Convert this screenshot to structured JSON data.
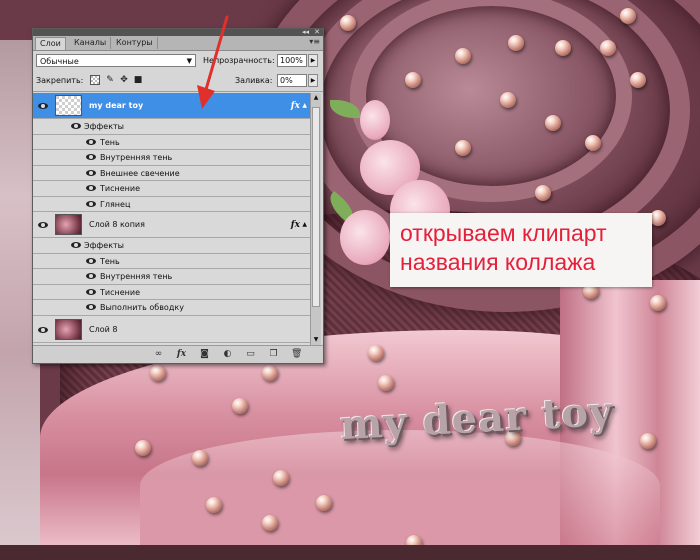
{
  "panel": {
    "tabs": [
      "Слои",
      "Каналы",
      "Контуры"
    ],
    "active_tab": 0,
    "collapse_glyph": "◂◂",
    "close_glyph": "✕",
    "menu_glyph": "▾≡",
    "blend_mode": "Обычные",
    "opacity_label": "Непрозрачность:",
    "opacity_value": "100%",
    "lock_label": "Закрепить:",
    "fill_label": "Заливка:",
    "fill_value": "0%",
    "lock_icons": [
      "lock-transparent-icon",
      "lock-paint-icon",
      "lock-move-icon",
      "lock-all-icon"
    ]
  },
  "layers": [
    {
      "name": "my dear toy",
      "selected": true,
      "thumb": "transparent",
      "fx": "fx"
    },
    {
      "effects_label": "Эффекты",
      "effects": [
        "Тень",
        "Внутренняя тень",
        "Внешнее свечение",
        "Тиснение",
        "Глянец"
      ]
    },
    {
      "name": "Слой 8 копия",
      "selected": false,
      "thumb": "image",
      "fx": "fx"
    },
    {
      "effects_label": "Эффекты",
      "effects": [
        "Тень",
        "Внутренняя тень",
        "Тиснение",
        "Выполнить обводку"
      ]
    },
    {
      "name": "Слой 8",
      "selected": false,
      "thumb": "image"
    }
  ],
  "bottom_icons": [
    "link-layers-icon",
    "fx-icon",
    "add-mask-icon",
    "adjustment-layer-icon",
    "new-group-icon",
    "new-layer-icon",
    "trash-icon"
  ],
  "caption": {
    "line1": "открываем клипарт",
    "line2": "названия коллажа"
  },
  "title_art": "my dear toy",
  "colors": {
    "selection": "#3f8fe6",
    "caption_text": "#e5203b",
    "arrow": "#e0302b"
  }
}
